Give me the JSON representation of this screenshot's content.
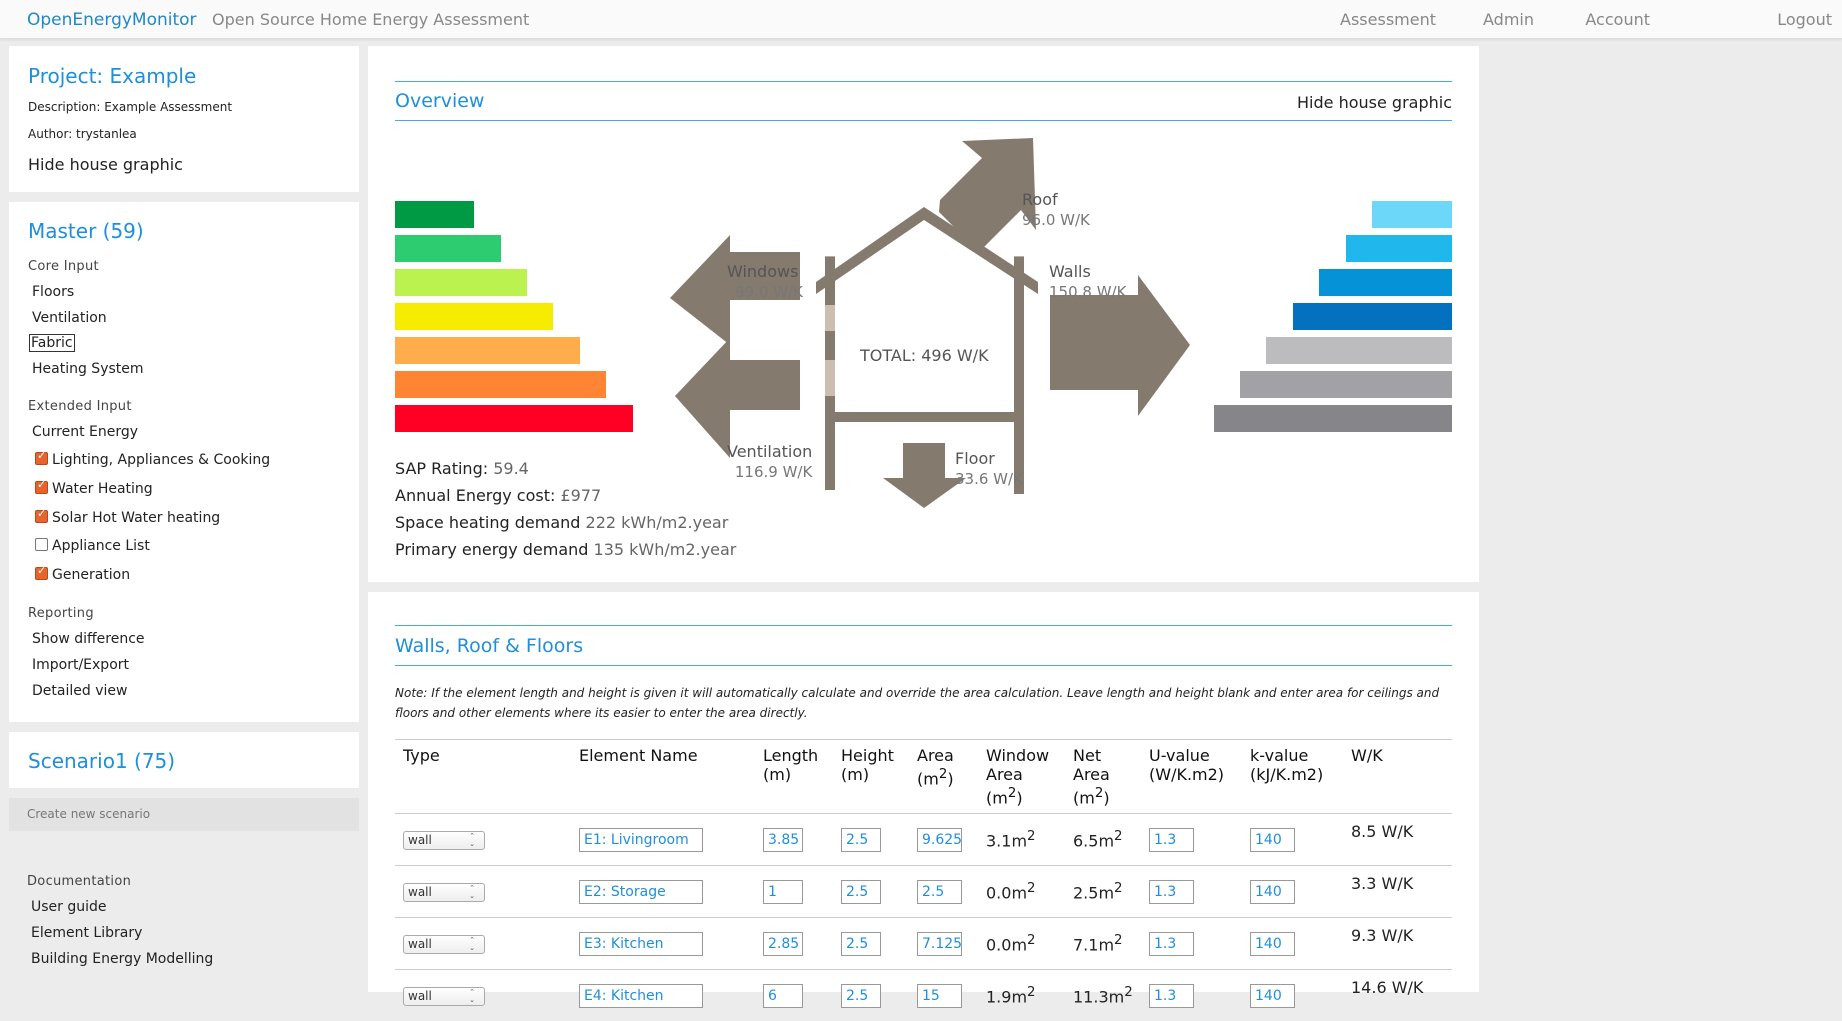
{
  "topbar": {
    "brand": "OpenEnergyMonitor",
    "subtitle": "Open Source Home Energy Assessment",
    "nav": [
      "Assessment",
      "Admin",
      "Account",
      "Logout"
    ]
  },
  "project": {
    "title": "Project: Example",
    "description": "Description: Example Assessment",
    "author": "Author: trystanlea",
    "hide_graphic": "Hide house graphic"
  },
  "master": {
    "title": "Master (59)",
    "core_input_label": "Core Input",
    "core_input": [
      "Floors",
      "Ventilation",
      "Fabric",
      "Heating System"
    ],
    "extended_input_label": "Extended Input",
    "current_energy": "Current Energy",
    "extended": [
      {
        "label": "Lighting, Appliances & Cooking",
        "checked": true
      },
      {
        "label": "Water Heating",
        "checked": true
      },
      {
        "label": "Solar Hot Water heating",
        "checked": true
      },
      {
        "label": "Appliance List",
        "checked": false
      },
      {
        "label": "Generation",
        "checked": true
      }
    ],
    "reporting_label": "Reporting",
    "reporting": [
      "Show difference",
      "Import/Export",
      "Detailed view"
    ]
  },
  "scenario": {
    "title": "Scenario1 (75)",
    "create_new": "Create new scenario"
  },
  "documentation": {
    "label": "Documentation",
    "items": [
      "User guide",
      "Element Library",
      "Building Energy Modelling"
    ]
  },
  "overview": {
    "title": "Overview",
    "hide_graphic": "Hide house graphic",
    "stats": [
      {
        "label": "SAP Rating:",
        "value": "59.4"
      },
      {
        "label": "Annual Energy cost:",
        "value": "£977"
      },
      {
        "label": "Space heating demand",
        "value": "222 kWh/m2.year"
      },
      {
        "label": "Primary energy demand",
        "value": "135 kWh/m2.year"
      }
    ],
    "house": {
      "total": "TOTAL: 496 W/K",
      "roof_label": "Roof",
      "roof_value": "96.0 W/K",
      "windows_label": "Windows",
      "windows_value": "99.0 W/K",
      "walls_label": "Walls",
      "walls_value": "150.8 W/K",
      "ventilation_label": "Ventilation",
      "ventilation_value": "116.9 W/K",
      "floor_label": "Floor",
      "floor_value": "33.6 W/K"
    },
    "colors": {
      "sap": [
        "#009a44",
        "#2dcc70",
        "#bbf24f",
        "#f5ec00",
        "#ffac4d",
        "#ff8433",
        "#ff0024"
      ],
      "ei": [
        "#6dd7fa",
        "#1fb7ec",
        "#0592d6",
        "#0470c0",
        "#bcbcbe",
        "#a2a2a6",
        "#86868a"
      ]
    }
  },
  "walls": {
    "title": "Walls, Roof & Floors",
    "note": "Note: If the element length and height is given it will automatically calculate and override the area calculation. Leave length and height blank and enter area for ceilings and floors and other elements where its easier to enter the area directly.",
    "headers": {
      "type": "Type",
      "name": "Element Name",
      "length": [
        "Length",
        "(m)"
      ],
      "height": [
        "Height",
        "(m)"
      ],
      "area": [
        "Area",
        "(m",
        "2",
        ")"
      ],
      "window_area": [
        "Window",
        "Area",
        "(m",
        "2",
        ")"
      ],
      "net_area": [
        "Net",
        "Area",
        "(m",
        "2",
        ")"
      ],
      "uvalue": [
        "U-value",
        "(W/K.m2)"
      ],
      "kvalue": [
        "k-value",
        "(kJ/K.m2)"
      ],
      "wk": "W/K"
    },
    "rows": [
      {
        "type": "wall",
        "name": "E1: Livingroom",
        "length": "3.85",
        "height": "2.5",
        "area": "9.625",
        "window_area": "3.1m",
        "net_area": "6.5m",
        "sup": "2",
        "uvalue": "1.3",
        "kvalue": "140",
        "wk": "8.5 W/K"
      },
      {
        "type": "wall",
        "name": "E2: Storage",
        "length": "1",
        "height": "2.5",
        "area": "2.5",
        "window_area": "0.0m",
        "net_area": "2.5m",
        "sup": "2",
        "uvalue": "1.3",
        "kvalue": "140",
        "wk": "3.3 W/K"
      },
      {
        "type": "wall",
        "name": "E3: Kitchen",
        "length": "2.85",
        "height": "2.5",
        "area": "7.125",
        "window_area": "0.0m",
        "net_area": "7.1m",
        "sup": "2",
        "uvalue": "1.3",
        "kvalue": "140",
        "wk": "9.3 W/K"
      },
      {
        "type": "wall",
        "name": "E4: Kitchen",
        "length": "6",
        "height": "2.5",
        "area": "15",
        "window_area": "1.9m",
        "net_area": "11.3m",
        "sup": "2",
        "uvalue": "1.3",
        "kvalue": "140",
        "wk": "14.6 W/K"
      }
    ]
  }
}
